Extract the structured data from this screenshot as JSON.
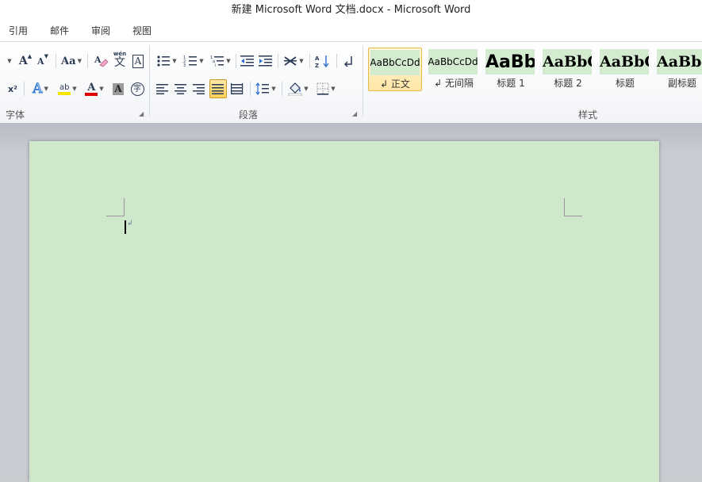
{
  "window": {
    "title": "新建 Microsoft Word 文档.docx  -  Microsoft Word"
  },
  "menu": {
    "items": [
      "引用",
      "邮件",
      "审阅",
      "视图"
    ]
  },
  "ribbon": {
    "font_group": {
      "label": "字体",
      "grow_font_glyph": "A",
      "shrink_font_glyph": "A",
      "change_case_glyph": "Aa",
      "phonetic_glyph": "文",
      "phonetic_top": "wén",
      "char_border_glyph": "A",
      "superscript_glyph": "x²",
      "text_effect_glyph": "A",
      "highlight_glyph": "ab",
      "font_color_glyph": "A",
      "char_shading_glyph": "A",
      "enclose_glyph": "字",
      "highlight_color": "#f5e600",
      "font_color": "#e00000"
    },
    "paragraph_group": {
      "label": "段落"
    },
    "styles_group": {
      "label": "样式",
      "tiles": [
        {
          "sample": "AaBbCcDd",
          "name": "↲ 正文",
          "selected": true
        },
        {
          "sample": "AaBbCcDd",
          "name": "↲ 无间隔",
          "selected": false
        },
        {
          "sample": "AaBb",
          "name": "标题 1",
          "selected": false
        },
        {
          "sample": "AaBbC",
          "name": "标题 2",
          "selected": false
        },
        {
          "sample": "AaBbC",
          "name": "标题",
          "selected": false
        },
        {
          "sample": "AaBbC",
          "name": "副标题",
          "selected": false
        }
      ]
    }
  },
  "document": {
    "background": "#cfe8cc",
    "paragraph_mark": "↲"
  },
  "colors": {
    "accent_selected": "#e8b84a",
    "page_bg": "#cfe8cc",
    "style_sample_bg": "#d3ecd0"
  }
}
